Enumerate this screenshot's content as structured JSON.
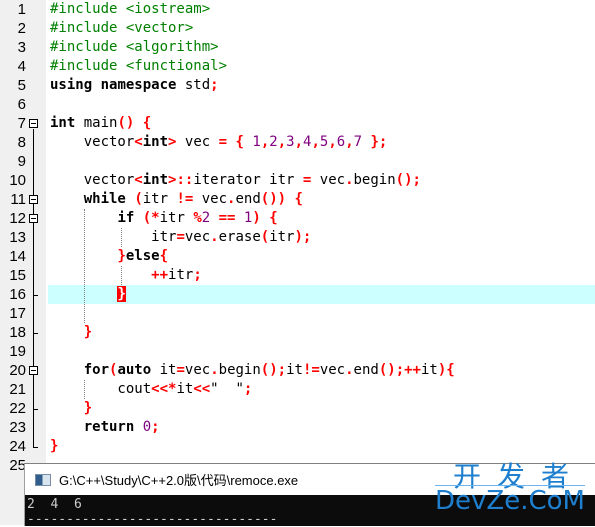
{
  "editor": {
    "current_line": 16,
    "lines": [
      {
        "n": "1",
        "tokens": [
          [
            "pp",
            "#include <iostream>"
          ]
        ]
      },
      {
        "n": "2",
        "tokens": [
          [
            "pp",
            "#include <vector>"
          ]
        ]
      },
      {
        "n": "3",
        "tokens": [
          [
            "pp",
            "#include <algorithm>"
          ]
        ]
      },
      {
        "n": "4",
        "tokens": [
          [
            "pp",
            "#include <functional>"
          ]
        ]
      },
      {
        "n": "5",
        "tokens": [
          [
            "kw",
            "using"
          ],
          [
            "",
            " "
          ],
          [
            "kw",
            "namespace"
          ],
          [
            "",
            " std"
          ],
          [
            "op",
            ";"
          ]
        ]
      },
      {
        "n": "6",
        "tokens": []
      },
      {
        "n": "7",
        "tokens": [
          [
            "kw",
            "int"
          ],
          [
            "",
            " main"
          ],
          [
            "op",
            "()"
          ],
          [
            "",
            " "
          ],
          [
            "op",
            "{"
          ]
        ]
      },
      {
        "n": "8",
        "tokens": [
          [
            "",
            "    vector"
          ],
          [
            "op",
            "<"
          ],
          [
            "kw",
            "int"
          ],
          [
            "op",
            ">"
          ],
          [
            "",
            " vec "
          ],
          [
            "op",
            "="
          ],
          [
            "",
            " "
          ],
          [
            "op",
            "{"
          ],
          [
            "",
            " "
          ],
          [
            "num",
            "1"
          ],
          [
            "op",
            ","
          ],
          [
            "num",
            "2"
          ],
          [
            "op",
            ","
          ],
          [
            "num",
            "3"
          ],
          [
            "op",
            ","
          ],
          [
            "num",
            "4"
          ],
          [
            "op",
            ","
          ],
          [
            "num",
            "5"
          ],
          [
            "op",
            ","
          ],
          [
            "num",
            "6"
          ],
          [
            "op",
            ","
          ],
          [
            "num",
            "7"
          ],
          [
            "",
            " "
          ],
          [
            "op",
            "};"
          ]
        ]
      },
      {
        "n": "9",
        "tokens": []
      },
      {
        "n": "10",
        "tokens": [
          [
            "",
            "    vector"
          ],
          [
            "op",
            "<"
          ],
          [
            "kw",
            "int"
          ],
          [
            "op",
            ">::"
          ],
          [
            "",
            "iterator itr "
          ],
          [
            "op",
            "="
          ],
          [
            "",
            " vec"
          ],
          [
            "op",
            "."
          ],
          [
            "",
            "begin"
          ],
          [
            "op",
            "();"
          ]
        ]
      },
      {
        "n": "11",
        "tokens": [
          [
            "",
            "    "
          ],
          [
            "kw",
            "while"
          ],
          [
            "",
            " "
          ],
          [
            "op",
            "("
          ],
          [
            "",
            "itr "
          ],
          [
            "op",
            "!="
          ],
          [
            "",
            " vec"
          ],
          [
            "op",
            "."
          ],
          [
            "",
            "end"
          ],
          [
            "op",
            "())"
          ],
          [
            "",
            " "
          ],
          [
            "op",
            "{"
          ]
        ]
      },
      {
        "n": "12",
        "tokens": [
          [
            "",
            "        "
          ],
          [
            "kw",
            "if"
          ],
          [
            "",
            " "
          ],
          [
            "op",
            "(*"
          ],
          [
            "",
            "itr "
          ],
          [
            "op",
            "%"
          ],
          [
            "num",
            "2"
          ],
          [
            "",
            " "
          ],
          [
            "op",
            "=="
          ],
          [
            "",
            " "
          ],
          [
            "num",
            "1"
          ],
          [
            "op",
            ")"
          ],
          [
            "",
            " "
          ],
          [
            "op",
            "{"
          ]
        ]
      },
      {
        "n": "13",
        "tokens": [
          [
            "",
            "            itr"
          ],
          [
            "op",
            "="
          ],
          [
            "",
            "vec"
          ],
          [
            "op",
            "."
          ],
          [
            "",
            "erase"
          ],
          [
            "op",
            "("
          ],
          [
            "",
            "itr"
          ],
          [
            "op",
            ");"
          ]
        ]
      },
      {
        "n": "14",
        "tokens": [
          [
            "",
            "        "
          ],
          [
            "op",
            "}"
          ],
          [
            "kw",
            "else"
          ],
          [
            "op",
            "{"
          ]
        ]
      },
      {
        "n": "15",
        "tokens": [
          [
            "",
            "            "
          ],
          [
            "op",
            "++"
          ],
          [
            "",
            "itr"
          ],
          [
            "op",
            ";"
          ]
        ]
      },
      {
        "n": "16",
        "tokens": [
          [
            "",
            "        "
          ],
          [
            "brace-match",
            "}"
          ]
        ]
      },
      {
        "n": "17",
        "tokens": []
      },
      {
        "n": "18",
        "tokens": [
          [
            "",
            "    "
          ],
          [
            "op",
            "}"
          ]
        ]
      },
      {
        "n": "19",
        "tokens": []
      },
      {
        "n": "20",
        "tokens": [
          [
            "",
            "    "
          ],
          [
            "kw",
            "for"
          ],
          [
            "op",
            "("
          ],
          [
            "kw",
            "auto"
          ],
          [
            "",
            " it"
          ],
          [
            "op",
            "="
          ],
          [
            "",
            "vec"
          ],
          [
            "op",
            "."
          ],
          [
            "",
            "begin"
          ],
          [
            "op",
            "();"
          ],
          [
            "",
            "it"
          ],
          [
            "op",
            "!="
          ],
          [
            "",
            "vec"
          ],
          [
            "op",
            "."
          ],
          [
            "",
            "end"
          ],
          [
            "op",
            "();++"
          ],
          [
            "",
            "it"
          ],
          [
            "op",
            "){"
          ]
        ]
      },
      {
        "n": "21",
        "tokens": [
          [
            "",
            "        cout"
          ],
          [
            "op",
            "<<*"
          ],
          [
            "",
            "it"
          ],
          [
            "op",
            "<<"
          ],
          [
            "str",
            "\"  \""
          ],
          [
            "op",
            ";"
          ]
        ]
      },
      {
        "n": "22",
        "tokens": [
          [
            "",
            "    "
          ],
          [
            "op",
            "}"
          ]
        ]
      },
      {
        "n": "23",
        "tokens": [
          [
            "",
            "    "
          ],
          [
            "kw",
            "return"
          ],
          [
            "",
            " "
          ],
          [
            "num",
            "0"
          ],
          [
            "op",
            ";"
          ]
        ]
      },
      {
        "n": "24",
        "tokens": [
          [
            "op",
            "}"
          ]
        ]
      },
      {
        "n": "25",
        "tokens": []
      }
    ]
  },
  "console": {
    "title": "G:\\C++\\Study\\C++2.0版\\代码\\remoce.exe",
    "output": "2  4  6",
    "separator": "--------------------------------"
  },
  "watermark": {
    "chinese": "开发者",
    "english": "DevZe.CoM"
  }
}
